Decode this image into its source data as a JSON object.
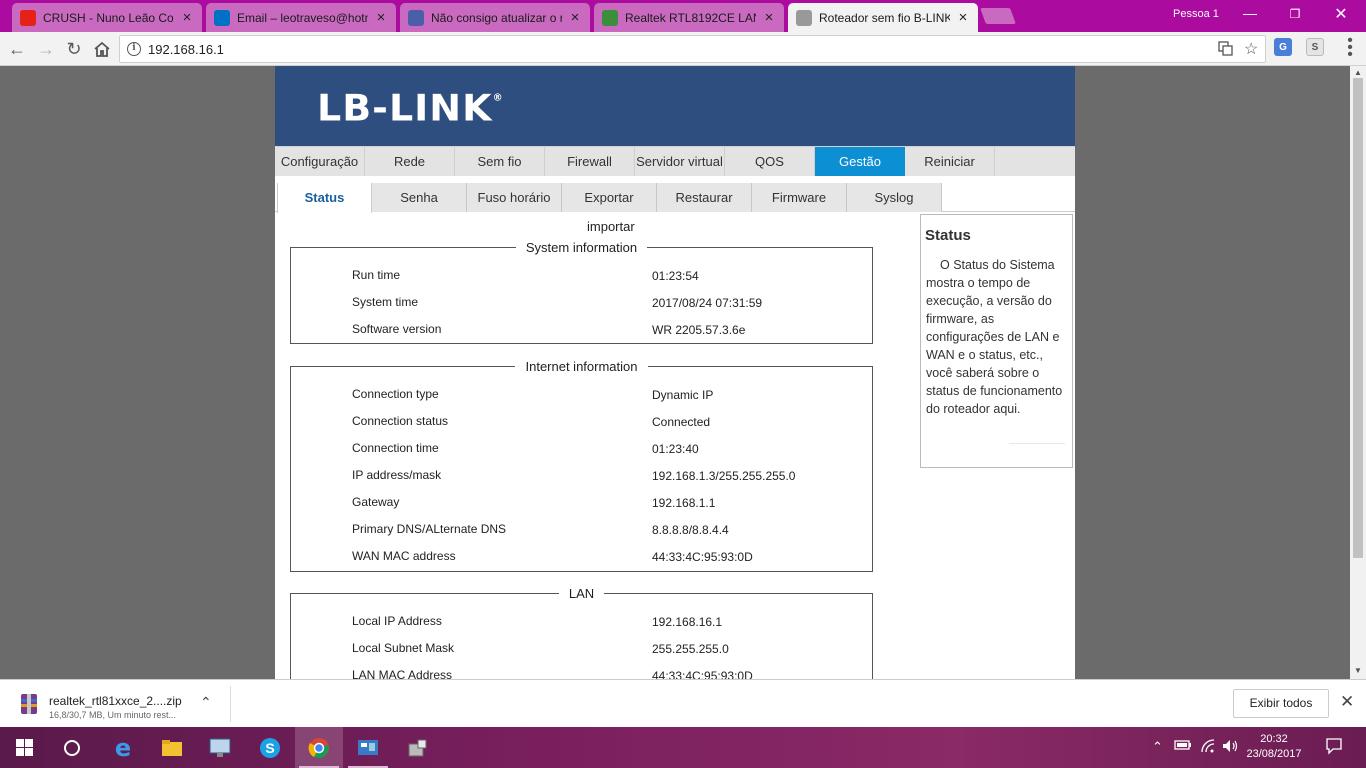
{
  "browser": {
    "tabs": [
      {
        "title": "CRUSH - Nuno Leão Con",
        "icon": "youtube-icon",
        "color": "#e62117",
        "active": false
      },
      {
        "title": "Email – leotraveso@hotm",
        "icon": "outlook-icon",
        "color": "#0072c6",
        "active": false
      },
      {
        "title": "Não consigo atualizar o r",
        "icon": "forum-icon",
        "color": "#4a5fa8",
        "active": false
      },
      {
        "title": "Realtek RTL8192CE LAN d",
        "icon": "driver-icon",
        "color": "#3c8d3c",
        "active": false
      },
      {
        "title": "Roteador sem fio B-LINK",
        "icon": "page-icon",
        "color": "#999999",
        "active": true
      }
    ],
    "profile": "Pessoa 1",
    "url": "192.168.16.1"
  },
  "router": {
    "logo": "LB-LINK",
    "main_nav": [
      {
        "label": "Configuração",
        "active": false
      },
      {
        "label": "Rede",
        "active": false
      },
      {
        "label": "Sem fio",
        "active": false
      },
      {
        "label": "Firewall",
        "active": false
      },
      {
        "label": "Servidor virtual",
        "active": false
      },
      {
        "label": "QOS",
        "active": false
      },
      {
        "label": "Gestão",
        "active": true
      },
      {
        "label": "Reiniciar",
        "active": false
      }
    ],
    "sub_nav": [
      {
        "label": "Status",
        "active": true
      },
      {
        "label": "Senha",
        "active": false
      },
      {
        "label": "Fuso horário",
        "active": false
      },
      {
        "label": "Exportar",
        "active": false
      },
      {
        "label": "Restaurar",
        "active": false
      },
      {
        "label": "Firmware",
        "active": false
      },
      {
        "label": "Syslog",
        "active": false
      }
    ],
    "importar": "importar",
    "system": {
      "legend": "System information",
      "rows": [
        {
          "label": "Run time",
          "value": "01:23:54"
        },
        {
          "label": "System time",
          "value": "2017/08/24 07:31:59"
        },
        {
          "label": "Software version",
          "value": "WR 2205.57.3.6e"
        }
      ]
    },
    "internet": {
      "legend": "Internet information",
      "rows": [
        {
          "label": "Connection type",
          "value": "Dynamic IP"
        },
        {
          "label": "Connection status",
          "value": "Connected"
        },
        {
          "label": "Connection time",
          "value": "01:23:40"
        },
        {
          "label": "IP address/mask",
          "value": "192.168.1.3/255.255.255.0"
        },
        {
          "label": "Gateway",
          "value": "192.168.1.1"
        },
        {
          "label": "Primary DNS/ALternate DNS",
          "value": "8.8.8.8/8.8.4.4"
        },
        {
          "label": "WAN MAC address",
          "value": "44:33:4C:95:93:0D"
        }
      ]
    },
    "lan": {
      "legend": "LAN",
      "rows": [
        {
          "label": "Local IP Address",
          "value": "192.168.16.1"
        },
        {
          "label": "Local Subnet Mask",
          "value": "255.255.255.0"
        },
        {
          "label": "LAN MAC Address",
          "value": "44:33:4C:95:93:0D"
        }
      ]
    },
    "help": {
      "title": "Status",
      "text": "O Status do Sistema mostra o tempo de execução, a versão do firmware, as configurações de LAN e WAN e o status, etc., você saberá sobre o status de funcionamento do roteador aqui."
    }
  },
  "downloads": {
    "file_name": "realtek_rtl81xxce_2....zip",
    "status": "16,8/30,7 MB, Um minuto rest...",
    "show_all": "Exibir todos"
  },
  "taskbar": {
    "time": "20:32",
    "date": "23/08/2017"
  }
}
